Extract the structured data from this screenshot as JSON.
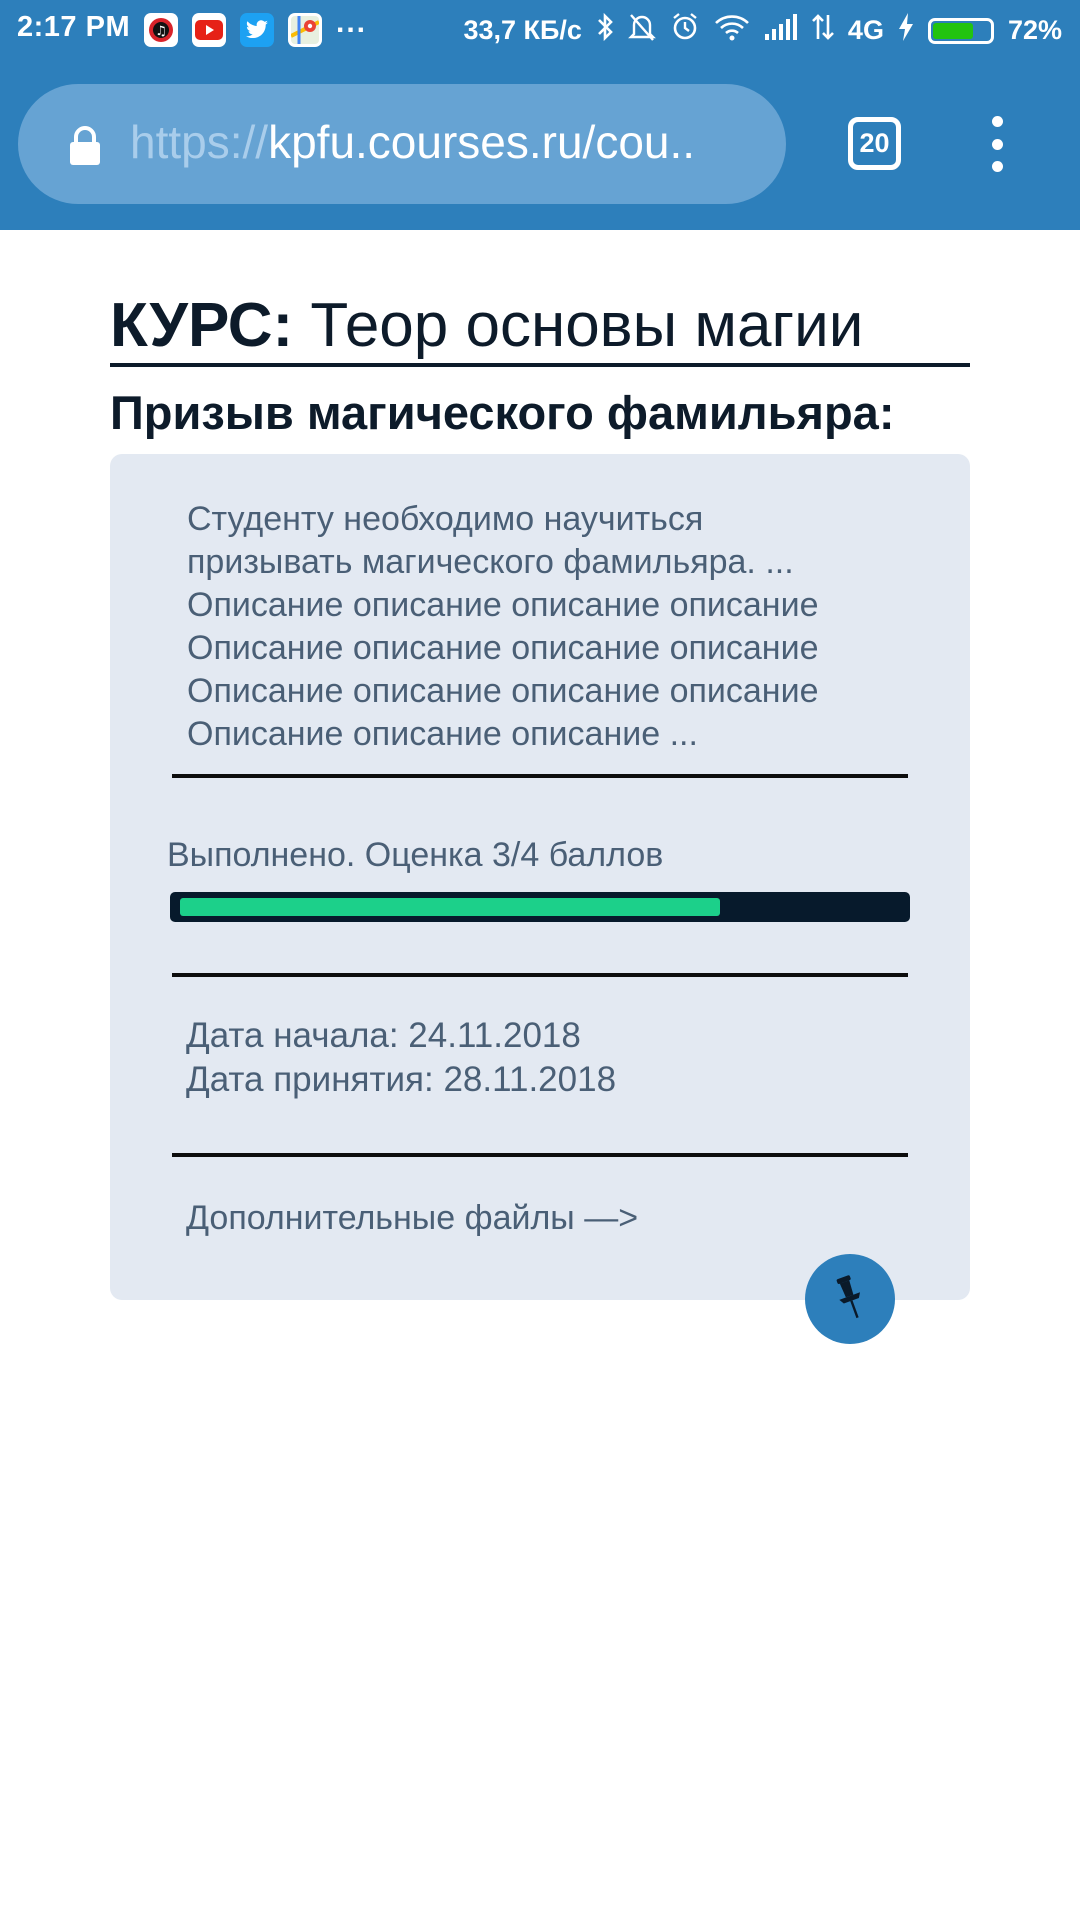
{
  "status_bar": {
    "time": "2:17 PM",
    "more_indicator": "...",
    "network_speed": "33,7 КБ/с",
    "network_type": "4G",
    "battery_percent": "72%",
    "battery_level": 0.72,
    "app_icons": [
      "music-app-icon",
      "youtube-icon",
      "twitter-icon",
      "maps-icon"
    ],
    "status_icons": [
      "bluetooth-icon",
      "mute-icon",
      "alarm-icon",
      "wifi-icon",
      "signal-icon",
      "data-arrows-icon",
      "charging-icon"
    ]
  },
  "browser": {
    "url_scheme": "https://",
    "url_host": "kpfu.courses.ru/cou..",
    "tab_count": "20",
    "colors": {
      "toolbar": "#2d7fbb",
      "url_bar": "#66a3d3"
    }
  },
  "page": {
    "course_label": "КУРС:",
    "course_name": "Теор основы магии",
    "task_title": "Призыв магического фамильяра:",
    "description_lines": [
      "Студенту необходимо научиться",
      "призывать магического фамильяра. ...",
      "Описание описание описание описание",
      "Описание описание описание описание",
      "Описание описание описание описание",
      "Описание описание описание ..."
    ],
    "status_text": "Выполнено. Оценка 3/4 баллов",
    "progress_value": 0.75,
    "start_date": "Дата начала: 24.11.2018",
    "accept_date": "Дата принятия: 28.11.2018",
    "files_link": "Дополнительные файлы —>",
    "colors": {
      "card_bg": "#e3e9f2",
      "progress_fill": "#1cd08a",
      "progress_track": "#071a2c",
      "text_muted": "#4a5f76",
      "heading": "#0d1b2a",
      "fab": "#2d7fbb"
    }
  }
}
